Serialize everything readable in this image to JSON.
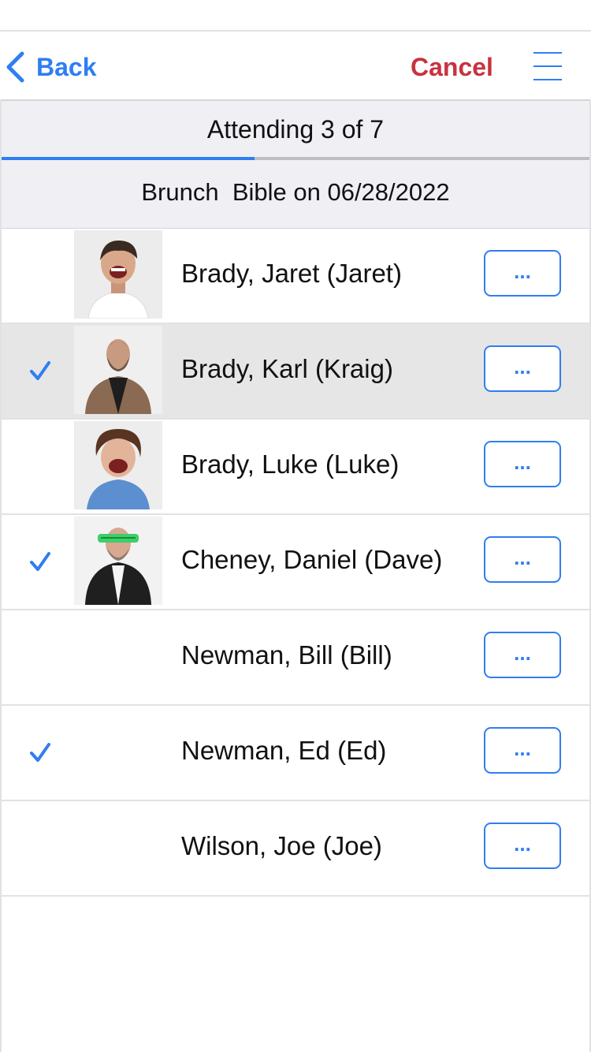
{
  "nav": {
    "back_label": "Back",
    "cancel_label": "Cancel",
    "menu_icon": "hamburger-menu-icon"
  },
  "attendance": {
    "label": "Attending 3 of 7",
    "attending": 3,
    "total": 7,
    "progress_fraction": 0.43
  },
  "event": {
    "title": "Brunch  Bible on 06/28/2022"
  },
  "colors": {
    "accent": "#2f7ef2",
    "cancel": "#c8323f",
    "selected_row": "#e6e6e6",
    "header_bg": "#efeff4"
  },
  "people": [
    {
      "name": "Brady, Jaret (Jaret)",
      "checked": false,
      "selected": false,
      "photo": "child-laughing-white-shirt",
      "more_label": "..."
    },
    {
      "name": "Brady, Karl (Kraig)",
      "checked": true,
      "selected": true,
      "photo": "bearded-man-brown-jacket",
      "more_label": "..."
    },
    {
      "name": "Brady, Luke (Luke)",
      "checked": false,
      "selected": false,
      "photo": "child-laughing-blue-shirt",
      "more_label": "..."
    },
    {
      "name": "Cheney, Daniel (Dave)",
      "checked": true,
      "selected": false,
      "photo": "man-green-shutter-glasses",
      "more_label": "..."
    },
    {
      "name": "Newman, Bill (Bill)",
      "checked": false,
      "selected": false,
      "photo": null,
      "more_label": "..."
    },
    {
      "name": "Newman, Ed (Ed)",
      "checked": true,
      "selected": false,
      "photo": null,
      "more_label": "..."
    },
    {
      "name": "Wilson, Joe (Joe)",
      "checked": false,
      "selected": false,
      "photo": null,
      "more_label": "..."
    }
  ]
}
